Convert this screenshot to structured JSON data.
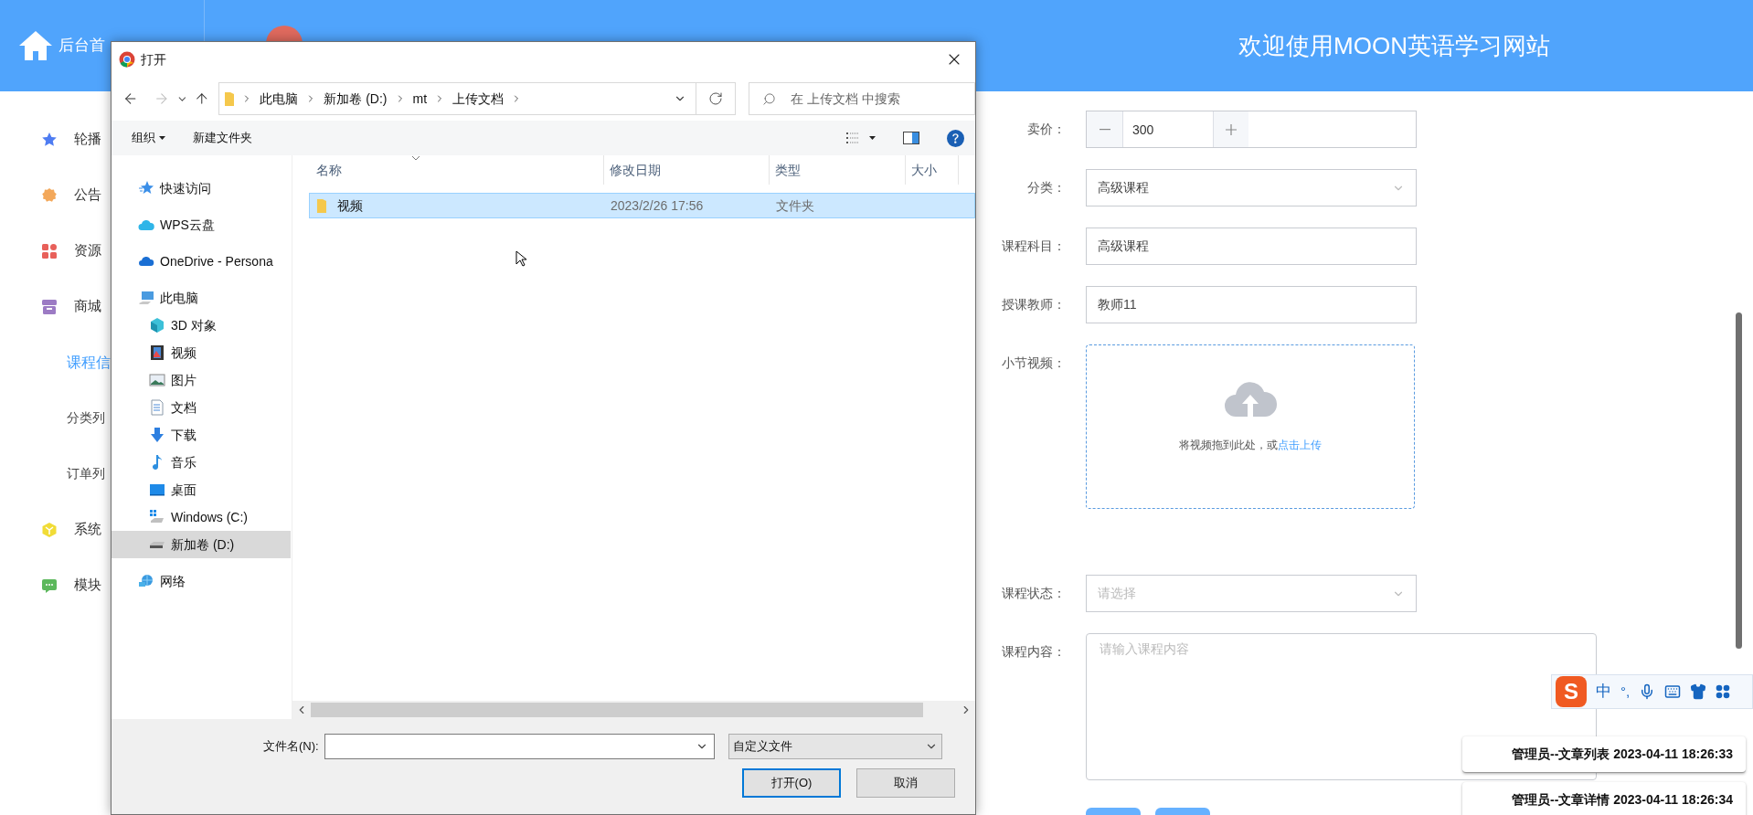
{
  "header": {
    "home_label": "后台首",
    "title": "欢迎使用MOON英语学习网站"
  },
  "sidebar": {
    "items": [
      {
        "label": "轮播",
        "color": "#4e7cf2",
        "selected": false
      },
      {
        "label": "公告",
        "color": "#f3a85a",
        "selected": false
      },
      {
        "label": "资源",
        "color": "#e8605a",
        "selected": false
      },
      {
        "label": "商城",
        "color": "#9c7bc4",
        "selected": false,
        "expanded": true,
        "children": [
          {
            "label": "课程信",
            "selected": true
          },
          {
            "label": "分类列",
            "selected": false
          },
          {
            "label": "订单列",
            "selected": false
          }
        ]
      },
      {
        "label": "系统",
        "color": "#f1dc37",
        "selected": false
      },
      {
        "label": "模块",
        "color": "#5cb85c",
        "selected": false
      }
    ]
  },
  "form": {
    "fields": [
      {
        "label": "卖价：",
        "kind": "number",
        "value": "300"
      },
      {
        "label": "分类：",
        "kind": "select",
        "value": "高级课程"
      },
      {
        "label": "课程科目：",
        "kind": "text",
        "value": "高级课程"
      },
      {
        "label": "授课教师：",
        "kind": "text",
        "value": "教师11"
      },
      {
        "label": "小节视频：",
        "kind": "upload",
        "hint": "将视频拖到此处，或",
        "link": "点击上传"
      },
      {
        "label": "课程状态：",
        "kind": "select",
        "placeholder": "请选择"
      },
      {
        "label": "课程内容：",
        "kind": "textarea",
        "placeholder": "请输入课程内容"
      }
    ]
  },
  "dialog": {
    "title": "打开",
    "path": [
      "此电脑",
      "新加卷 (D:)",
      "mt",
      "上传文档"
    ],
    "search": {
      "placeholder": "在 上传文档 中搜索"
    },
    "toolbar": [
      "组织",
      "新建文件夹"
    ],
    "nav": [
      {
        "label": "快速访问",
        "selected": false
      },
      {
        "label": "WPS云盘",
        "selected": false
      },
      {
        "label": "OneDrive - Persona",
        "selected": false
      },
      {
        "label": "此电脑",
        "selected": false,
        "children": [
          {
            "label": "3D 对象",
            "selected": false
          },
          {
            "label": "视频",
            "selected": false
          },
          {
            "label": "图片",
            "selected": false
          },
          {
            "label": "文档",
            "selected": false
          },
          {
            "label": "下载",
            "selected": false
          },
          {
            "label": "音乐",
            "selected": false
          },
          {
            "label": "桌面",
            "selected": false
          },
          {
            "label": "Windows (C:)",
            "selected": false
          },
          {
            "label": "新加卷 (D:)",
            "selected": true
          }
        ]
      },
      {
        "label": "网络",
        "selected": false
      }
    ],
    "columns": [
      "名称",
      "修改日期",
      "类型",
      "大小"
    ],
    "rows": [
      {
        "name": "视频",
        "modified": "2023/2/26 17:56",
        "type": "文件夹",
        "selected": true
      }
    ],
    "filename_label": "文件名(N):",
    "file_type": "自定义文件",
    "buttons": [
      {
        "label": "打开(O)",
        "default": true
      },
      {
        "label": "取消",
        "default": false
      }
    ]
  },
  "ime": {
    "logo": "S",
    "mode": "中",
    "punct": "°,"
  },
  "notifications": [
    "管理员--文章列表 2023-04-11 18:26:33",
    "管理员--文章详情 2023-04-11 18:26:34"
  ]
}
